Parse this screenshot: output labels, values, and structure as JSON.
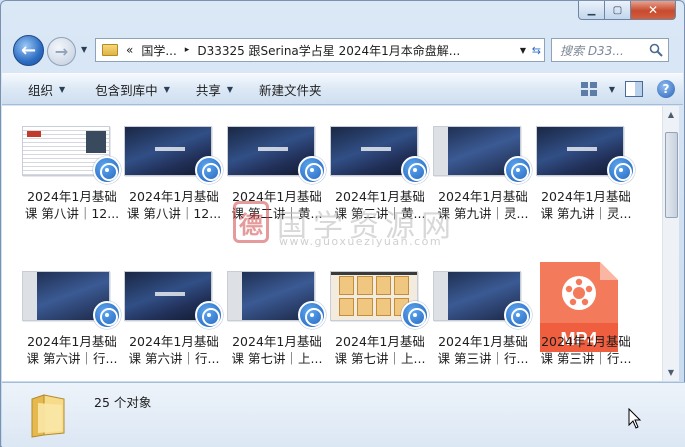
{
  "window": {
    "caption_min": "▁",
    "caption_max": "▢",
    "caption_close": "✕"
  },
  "nav": {
    "back_glyph": "←",
    "forward_glyph": "→",
    "breadcrumb_prefix": "«",
    "breadcrumb": [
      "国学...",
      "D33325 跟Serina学占星 2024年1月本命盘解..."
    ],
    "search_placeholder": "搜索 D33..."
  },
  "toolbar": {
    "organize": "组织",
    "include_in_library": "包含到库中",
    "share": "共享",
    "new_folder": "新建文件夹",
    "help": "?"
  },
  "files": [
    {
      "line1": "2024年1月基础",
      "line2": "课 第八讲｜12...",
      "thumb": "doc"
    },
    {
      "line1": "2024年1月基础",
      "line2": "课 第八讲｜12...",
      "thumb": "space"
    },
    {
      "line1": "2024年1月基础",
      "line2": "课 第二讲｜黄...",
      "thumb": "space"
    },
    {
      "line1": "2024年1月基础",
      "line2": "课 第二讲｜黄...",
      "thumb": "space"
    },
    {
      "line1": "2024年1月基础",
      "line2": "课 第九讲｜灵...",
      "thumb": "slides"
    },
    {
      "line1": "2024年1月基础",
      "line2": "课 第九讲｜灵...",
      "thumb": "space"
    },
    {
      "line1": "2024年1月基础",
      "line2": "课 第六讲｜行...",
      "thumb": "slides"
    },
    {
      "line1": "2024年1月基础",
      "line2": "课 第六讲｜行...",
      "thumb": "space"
    },
    {
      "line1": "2024年1月基础",
      "line2": "课 第七讲｜上...",
      "thumb": "slides"
    },
    {
      "line1": "2024年1月基础",
      "line2": "课 第七讲｜上...",
      "thumb": "cards"
    },
    {
      "line1": "2024年1月基础",
      "line2": "课 第三讲｜行...",
      "thumb": "slides"
    },
    {
      "line1": "2024年1月基础",
      "line2": "课 第三讲｜行...",
      "thumb": "mp4"
    }
  ],
  "mp4_label": "MP4",
  "watermark": {
    "seal": "德",
    "text": "国学资源网",
    "url": "www.guoxueziyuan.com"
  },
  "details": {
    "item_count": "25 个对象"
  }
}
